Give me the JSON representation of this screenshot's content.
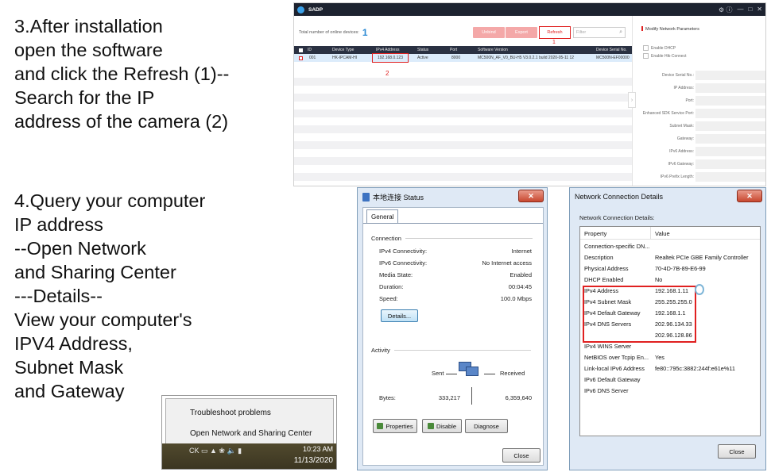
{
  "steps": {
    "step3": [
      "3.After installation",
      "open the software",
      "and click the Refresh (1)--",
      "Search for the IP",
      "address of the camera (2)"
    ],
    "step4": [
      "4.Query your computer",
      "IP address",
      "--Open Network",
      "and Sharing Center",
      "---Details--",
      "View your computer's",
      "IPV4 Address,",
      "Subnet Mask",
      "and Gateway"
    ]
  },
  "sadp": {
    "title": "SADP",
    "window_controls": [
      "⚙ ⓘ",
      "—",
      "□",
      "✕"
    ],
    "online_label": "Total number of online devices:",
    "online_count": "1",
    "unbind_label": "Unbind",
    "export_label": "Export",
    "refresh_label": "Refresh",
    "refresh_marker": "1",
    "filter_placeholder": "Filter",
    "columns": [
      "ID",
      "Device Type",
      "IPv4 Address",
      "Status",
      "Port",
      "Software Version",
      "Device Serial No."
    ],
    "row": {
      "id": "001",
      "device_type": "HK-IPCAM-HI",
      "ipv4": "192.168.0.123",
      "status": "Active",
      "port": "8000",
      "software": "MC500N_AF_V0_BU-H5 V3.0.2.1 build 2020-05-11 12",
      "serial": "MC500N-EF00000"
    },
    "ip_marker": "2",
    "panel": {
      "title": "Modify Network Parameters",
      "options": [
        "Enable DHCP",
        "Enable Hik-Connect"
      ],
      "fields": [
        "Device Serial No.:",
        "IP Address:",
        "Port:",
        "Enhanced SDK Service Port:",
        "Subnet Mask:",
        "Gateway:",
        "IPv6 Address:",
        "IPv6 Gateway:",
        "IPv6 Prefix Length:"
      ]
    }
  },
  "status_dialog": {
    "title": "本地连接 Status",
    "close_glyph": "✕",
    "tab": "General",
    "connection_label": "Connection",
    "rows": [
      {
        "label": "IPv4 Connectivity:",
        "value": "Internet"
      },
      {
        "label": "IPv6 Connectivity:",
        "value": "No Internet access"
      },
      {
        "label": "Media State:",
        "value": "Enabled"
      },
      {
        "label": "Duration:",
        "value": "00:04:45"
      },
      {
        "label": "Speed:",
        "value": "100.0 Mbps"
      }
    ],
    "details_label": "Details...",
    "activity_label": "Activity",
    "sent_label": "Sent",
    "received_label": "Received",
    "bytes_label": "Bytes:",
    "bytes_sent": "333,217",
    "bytes_received": "6,359,640",
    "properties_label": "Properties",
    "disable_label": "Disable",
    "diagnose_label": "Diagnose",
    "close_label": "Close"
  },
  "details_dialog": {
    "title": "Network Connection Details",
    "close_glyph": "✕",
    "subtitle": "Network Connection Details:",
    "col_property": "Property",
    "col_value": "Value",
    "rows": [
      {
        "property": "Connection-specific DN...",
        "value": ""
      },
      {
        "property": "Description",
        "value": "Realtek PCIe GBE Family Controller"
      },
      {
        "property": "Physical Address",
        "value": "70-4D-7B-89-E6-99"
      },
      {
        "property": "DHCP Enabled",
        "value": "No"
      },
      {
        "property": "IPv4 Address",
        "value": "192.168.1.11"
      },
      {
        "property": "IPv4 Subnet Mask",
        "value": "255.255.255.0"
      },
      {
        "property": "IPv4 Default Gateway",
        "value": "192.168.1.1"
      },
      {
        "property": "IPv4 DNS Servers",
        "value": "202.96.134.33"
      },
      {
        "property": "",
        "value": "202.96.128.86"
      },
      {
        "property": "IPv4 WINS Server",
        "value": ""
      },
      {
        "property": "NetBIOS over Tcpip En...",
        "value": "Yes"
      },
      {
        "property": "Link-local IPv6 Address",
        "value": "fe80::795c:3882:244f:e61e%11"
      },
      {
        "property": "IPv6 Default Gateway",
        "value": ""
      },
      {
        "property": "IPv6 DNS Server",
        "value": ""
      }
    ],
    "close_label": "Close"
  },
  "taskbar": {
    "menu_items": [
      "Troubleshoot problems",
      "Open Network and Sharing Center"
    ],
    "tray_text": "CK ▭ ▲ ❀ 🔈 ▮",
    "time": "10:23 AM",
    "date": "11/13/2020"
  }
}
